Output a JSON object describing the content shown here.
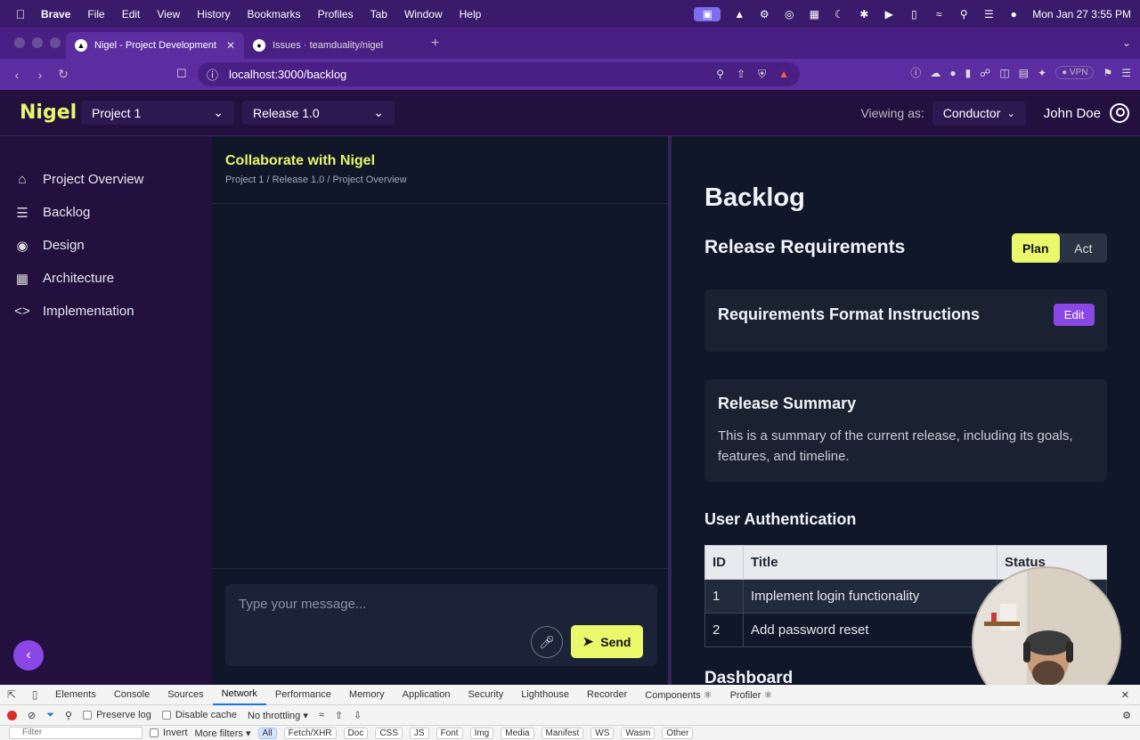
{
  "menubar": {
    "app": "Brave",
    "items": [
      "File",
      "Edit",
      "View",
      "History",
      "Bookmarks",
      "Profiles",
      "Tab",
      "Window",
      "Help"
    ],
    "clock": "Mon Jan 27  3:55 PM",
    "status_icons": [
      "screen-share-icon",
      "mountain-icon",
      "gear-icon",
      "grammarly-icon",
      "grid-icon",
      "moon-icon",
      "bluetooth-icon",
      "play-icon",
      "battery-icon",
      "wifi-icon",
      "search-icon",
      "control-center-icon",
      "siri-icon"
    ]
  },
  "browser": {
    "tabs": [
      {
        "label": "Nigel - Project Development",
        "active": true
      },
      {
        "label": "Issues · teamduality/nigel",
        "active": false
      }
    ],
    "url": "localhost:3000/backlog",
    "vpn_label": "VPN"
  },
  "app": {
    "logo": "Nigel",
    "project_select": "Project 1",
    "release_select": "Release 1.0",
    "viewing_label": "Viewing as:",
    "role_select": "Conductor",
    "user_name": "John Doe"
  },
  "sidebar": {
    "items": [
      {
        "label": "Project Overview",
        "icon": "home-icon"
      },
      {
        "label": "Backlog",
        "icon": "layers-icon"
      },
      {
        "label": "Design",
        "icon": "palette-icon"
      },
      {
        "label": "Architecture",
        "icon": "building-icon"
      },
      {
        "label": "Implementation",
        "icon": "code-icon"
      }
    ]
  },
  "chat": {
    "title": "Collaborate with Nigel",
    "breadcrumb": "Project 1 / Release 1.0 / Project Overview",
    "placeholder": "Type your message...",
    "send_label": "Send"
  },
  "backlog": {
    "title": "Backlog",
    "section_title": "Release Requirements",
    "toggle": {
      "plan": "Plan",
      "act": "Act",
      "selected": "Plan"
    },
    "format_card": {
      "title": "Requirements Format Instructions",
      "edit_label": "Edit"
    },
    "summary_card": {
      "title": "Release Summary",
      "body": "This is a summary of the current release, including its goals, features, and timeline."
    },
    "user_auth": {
      "title": "User Authentication",
      "columns": [
        "ID",
        "Title",
        "Status"
      ],
      "rows": [
        {
          "id": "1",
          "title": "Implement login functionality",
          "status": ""
        },
        {
          "id": "2",
          "title": "Add password reset",
          "status": ""
        }
      ]
    },
    "dashboard_title": "Dashboard"
  },
  "devtools": {
    "tabs": [
      "Elements",
      "Console",
      "Sources",
      "Network",
      "Performance",
      "Memory",
      "Application",
      "Security",
      "Lighthouse",
      "Recorder",
      "Components ⚛",
      "Profiler ⚛"
    ],
    "active_tab": "Network",
    "preserve_log": "Preserve log",
    "disable_cache": "Disable cache",
    "throttling": "No throttling",
    "filter_placeholder": "Filter",
    "invert": "Invert",
    "more_filters": "More filters",
    "type_filters": [
      "All",
      "Fetch/XHR",
      "Doc",
      "CSS",
      "JS",
      "Font",
      "Img",
      "Media",
      "Manifest",
      "WS",
      "Wasm",
      "Other"
    ]
  },
  "colors": {
    "accent_yellow": "#eaf86b",
    "accent_purple": "#8b47e6",
    "sidebar_bg": "#23103f",
    "panel_bg": "#0f1729"
  }
}
